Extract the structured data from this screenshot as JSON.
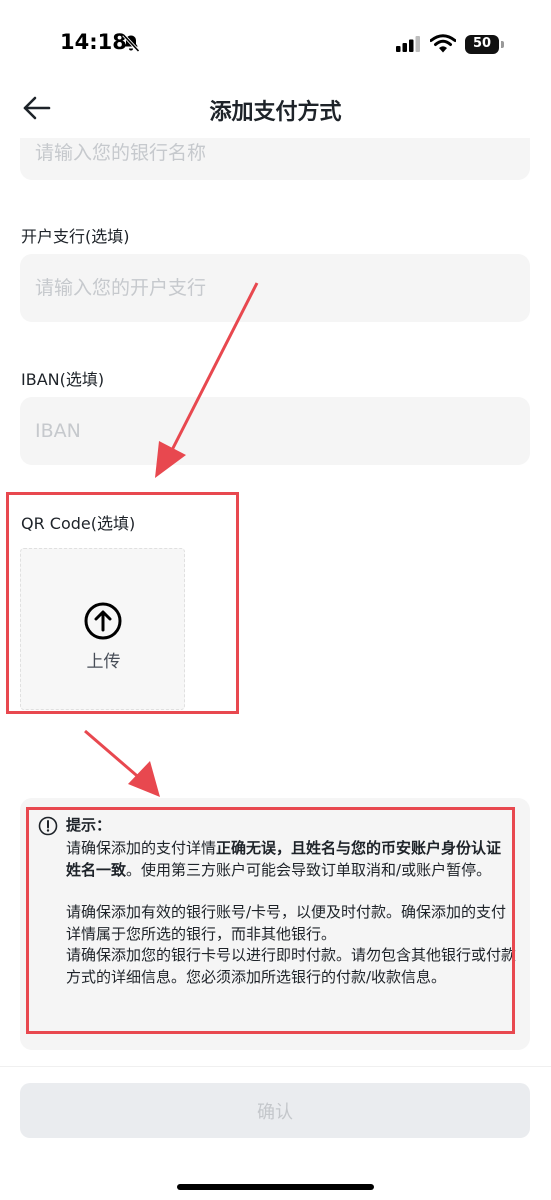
{
  "status_bar": {
    "time": "14:18",
    "battery": "50"
  },
  "nav": {
    "title": "添加支付方式"
  },
  "form": {
    "bank_name_placeholder": "请输入您的银行名称",
    "branch_label": "开户支行(选填)",
    "branch_placeholder": "请输入您的开户支行",
    "iban_label": "IBAN(选填)",
    "iban_placeholder": "IBAN",
    "qr_label": "QR Code(选填)",
    "upload_label": "上传"
  },
  "tip": {
    "title": "提示：",
    "p1_a": "请确保添加的支付详情",
    "p1_bold": "正确无误，且姓名与您的币安账户身份认证姓名一致",
    "p1_b": "。使用第三方账户可能会导致订单取消和/或账户暂停。",
    "p2": "请确保添加有效的银行账号/卡号，以便及时付款。确保添加的支付详情属于您所选的银行，而非其他银行。",
    "p3": "请确保添加您的银行卡号以进行即时付款。请勿包含其他银行或付款方式的详细信息。您必须添加所选银行的付款/收款信息。"
  },
  "footer": {
    "confirm_label": "确认"
  },
  "colors": {
    "annotation_red": "#e8484f",
    "input_bg": "#f5f5f5",
    "placeholder": "#c6c9cd",
    "button_disabled_bg": "#eaecef"
  },
  "icons": [
    "bell-slash-icon",
    "cellular-signal-icon",
    "wifi-icon",
    "battery-icon",
    "back-arrow-icon",
    "upload-arrow-icon",
    "info-circle-icon"
  ]
}
